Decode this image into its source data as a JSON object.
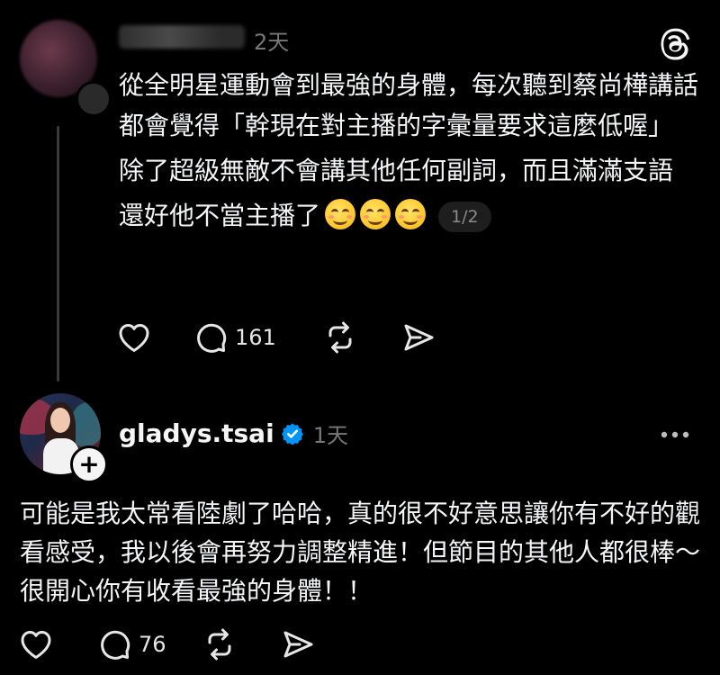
{
  "post": {
    "time": "2天",
    "paragraphs": [
      "從全明星運動會到最強的身體，每次聽到蔡尚樺講話都會覺得「幹現在對主播的字彙量要求這麼低喔」",
      "除了超級無敵不會講其他任何副詞，而且滿滿支語",
      "還好他不當主播了"
    ],
    "emoji_icon": "smiling-face-emoji",
    "emoji_count": 3,
    "page_indicator": "1/2",
    "reply_count": "161"
  },
  "reply": {
    "username": "gladys.tsai",
    "time": "1天",
    "text": "可能是我太常看陸劇了哈哈，真的很不好意思讓你有不好的觀看感受，我以後會再努力調整精進！但節目的其他人都很棒～很開心你有收看最強的身體！！",
    "follow_label": "+",
    "reply_count": "76"
  },
  "icons": {
    "like": "heart-icon",
    "reply": "comment-icon",
    "repost": "repost-icon",
    "share": "send-icon",
    "brand": "threads-logo-icon",
    "verified": "verified-badge-icon",
    "more": "more-options-icon"
  },
  "colors": {
    "background": "#000000",
    "text": "#f3f5f7",
    "muted": "#777777",
    "verified": "#0095f6"
  }
}
